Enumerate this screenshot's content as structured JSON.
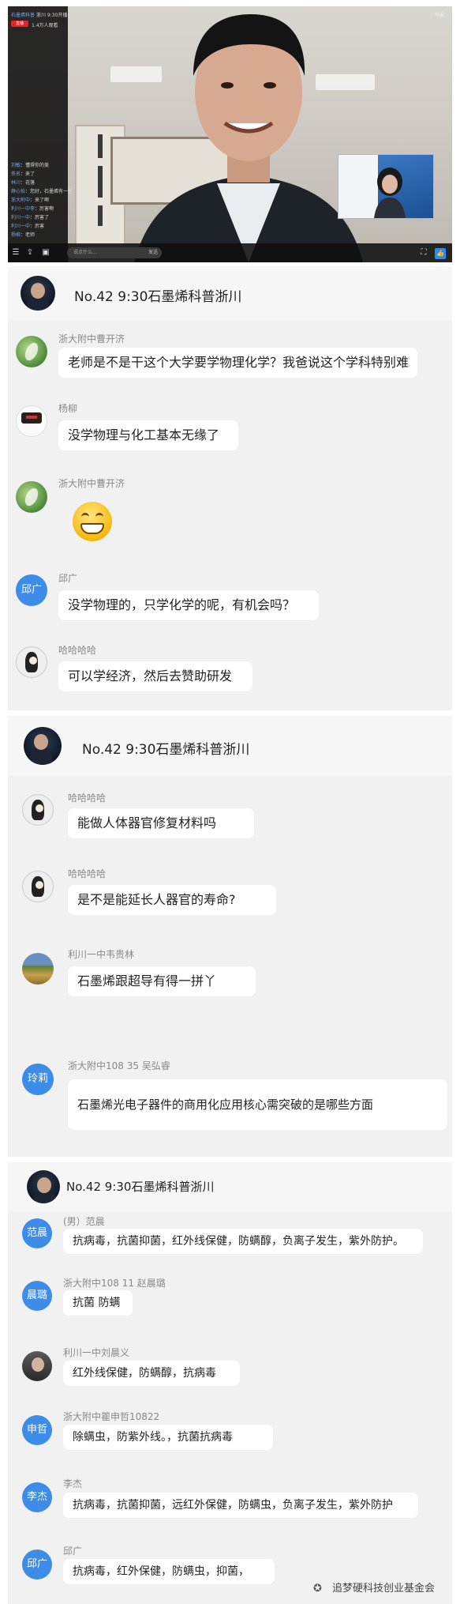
{
  "video": {
    "corner_label": "举报",
    "live_badge": "直播",
    "overlay_lines": [
      {
        "user": "石墨烯科普",
        "text": "浙川  9:30开播"
      },
      {
        "user": "",
        "text": "1.4万人观看"
      },
      {
        "user": "刘敏",
        "text": "懂得你的美"
      },
      {
        "user": "佚名",
        "text": "来了"
      },
      {
        "user": "林川",
        "text": "花落"
      },
      {
        "user": "薛心怡",
        "text": "您好，石墨烯有一些"
      },
      {
        "user": "浙大附中",
        "text": "来了啊"
      },
      {
        "user": "利川一中李",
        "text": "厉害啊"
      },
      {
        "user": "利川一中",
        "text": "厉害了"
      },
      {
        "user": "利川一中",
        "text": "厉害"
      },
      {
        "user": "杨柳",
        "text": "老师"
      }
    ],
    "input_placeholder": "说点什么...",
    "send_label": "发送"
  },
  "panels": [
    {
      "title": "No.42 9:30石墨烯科普浙川",
      "messages": [
        {
          "name": "浙大附中曹开济",
          "text": "老师是不是干这个大学要学物理化学？我爸说这个学科特别难"
        },
        {
          "name": "杨柳",
          "text": "没学物理与化工基本无缘了"
        },
        {
          "name": "浙大附中曹开济",
          "text": "😁"
        },
        {
          "name": "邱广",
          "avatar_text": "邱广",
          "text": "没学物理的，只学化学的呢，有机会吗？"
        },
        {
          "name": "哈哈哈哈",
          "text": "可以学经济，然后去赞助研发"
        }
      ]
    },
    {
      "title": "No.42 9:30石墨烯科普浙川",
      "messages": [
        {
          "name": "哈哈哈哈",
          "text": "能做人体器官修复材料吗"
        },
        {
          "name": "哈哈哈哈",
          "text": "是不是能延长人器官的寿命?"
        },
        {
          "name": "利川一中韦贵林",
          "text": "石墨烯跟超导有得一拼丫"
        },
        {
          "name": "浙大附中108 35 吴弘睿",
          "avatar_text": "玲莉",
          "text": "石墨烯光电子器件的商用化应用核心需突破的是哪些方面"
        }
      ]
    },
    {
      "title": "No.42 9:30石墨烯科普浙川",
      "messages": [
        {
          "name": "(男）范晨",
          "avatar_text": "范晨",
          "text": "抗病毒，抗菌抑菌，红外线保健，防螨醇，负离子发生，紫外防护。"
        },
        {
          "name": "浙大附中108 11 赵晨璐",
          "avatar_text": "晨璐",
          "text": "抗菌 防螨"
        },
        {
          "name": "利川一中刘晨义",
          "text": "红外线保健，防螨醇，抗病毒"
        },
        {
          "name": "浙大附中瞿申哲10822",
          "avatar_text": "申哲",
          "text": "除螨虫，防紫外线。，抗菌抗病毒"
        },
        {
          "name": "李杰",
          "avatar_text": "李杰",
          "text": "抗病毒，抗菌抑菌，远红外保健，防螨虫，负离子发生，紫外防护"
        },
        {
          "name": "邱广",
          "avatar_text": "邱广",
          "text": "抗病毒，红外保健，防螨虫，抑菌，"
        }
      ]
    }
  ],
  "watermark": "追梦硬科技创业基金会"
}
